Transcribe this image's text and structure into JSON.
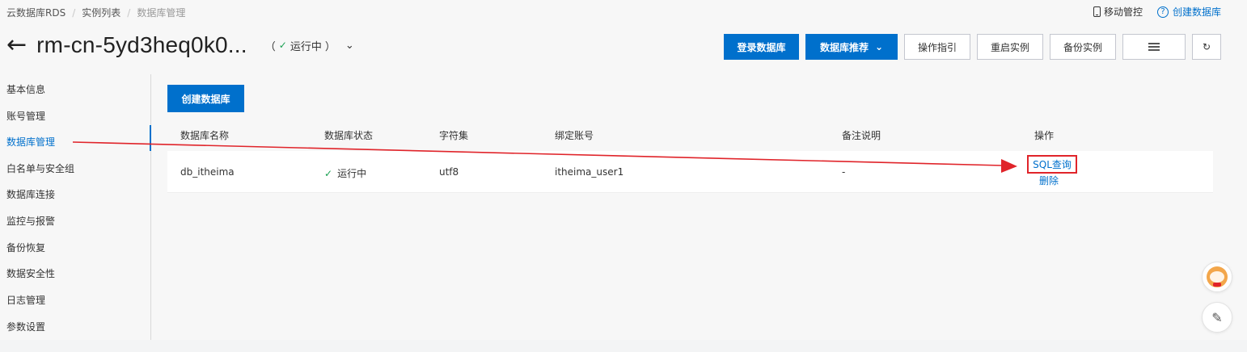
{
  "breadcrumb": {
    "item1": "云数据库RDS",
    "item2": "实例列表",
    "item3": "数据库管理"
  },
  "top_right": {
    "mobile_control": "移动管控",
    "create_db_link": "创建数据库"
  },
  "header": {
    "back_glyph": "←",
    "instance_id": "rm-cn-5yd3heq0k0...",
    "status_open": "（",
    "status_check": "✓",
    "status_text": "运行中",
    "status_close": "）",
    "status_chevron": "⌄"
  },
  "actions": {
    "login_db": "登录数据库",
    "db_recommend": "数据库推荐",
    "recommend_chevron": "⌄",
    "op_guide": "操作指引",
    "restart": "重启实例",
    "backup": "备份实例",
    "refresh_glyph": "↻"
  },
  "sidebar": {
    "items": [
      {
        "label": "基本信息"
      },
      {
        "label": "账号管理"
      },
      {
        "label": "数据库管理"
      },
      {
        "label": "白名单与安全组"
      },
      {
        "label": "数据库连接"
      },
      {
        "label": "监控与报警"
      },
      {
        "label": "备份恢复"
      },
      {
        "label": "数据安全性"
      },
      {
        "label": "日志管理"
      },
      {
        "label": "参数设置"
      }
    ],
    "active_index": 2
  },
  "main": {
    "create_db_button": "创建数据库",
    "columns": [
      "数据库名称",
      "数据库状态",
      "字符集",
      "绑定账号",
      "备注说明",
      "操作"
    ],
    "rows": [
      {
        "name": "db_itheima",
        "status_check": "✓",
        "status": "运行中",
        "charset": "utf8",
        "account": "itheima_user1",
        "remark": "-",
        "op_sql": "SQL查询",
        "op_delete": "删除"
      }
    ]
  },
  "float_buttons": {
    "edit_glyph": "✎"
  },
  "colors": {
    "accent": "#0070cc",
    "success": "#1aa052",
    "annotation_red": "#e0242a"
  }
}
